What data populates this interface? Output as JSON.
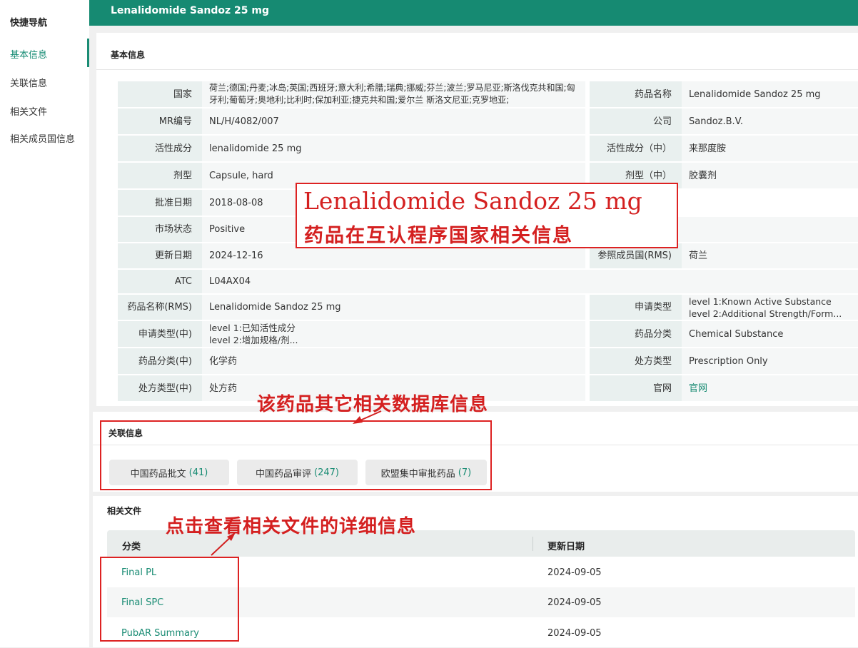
{
  "nav": {
    "title": "快捷导航",
    "items": [
      {
        "label": "基本信息",
        "active": true
      },
      {
        "label": "关联信息"
      },
      {
        "label": "相关文件"
      },
      {
        "label": "相关成员国信息"
      }
    ]
  },
  "header": {
    "title": "Lenalidomide Sandoz 25 mg"
  },
  "basic": {
    "title": "基本信息",
    "country_label": "国家",
    "country_value": "荷兰;德国;丹麦;冰岛;英国;西班牙;意大利;希腊;瑞典;挪威;芬兰;波兰;罗马尼亚;斯洛伐克共和国;匈牙利;葡萄牙;奥地利;比利时;保加利亚;捷克共和国;爱尔兰 斯洛文尼亚;克罗地亚;",
    "rows_left": [
      {
        "label": "MR编号",
        "value": "NL/H/4082/007"
      },
      {
        "label": "活性成分",
        "value": "lenalidomide 25 mg"
      },
      {
        "label": "剂型",
        "value": "Capsule, hard"
      },
      {
        "label": "批准日期",
        "value": "2018-08-08"
      },
      {
        "label": "市场状态",
        "value": " Positive"
      },
      {
        "label": "更新日期",
        "value": "2024-12-16"
      },
      {
        "label": "ATC",
        "value": " L04AX04"
      },
      {
        "label": "药品名称(RMS)",
        "value": "Lenalidomide Sandoz 25 mg"
      },
      {
        "label": "申请类型(中)",
        "value": "level 1:已知活性成分\nlevel 2:增加规格/剂..."
      },
      {
        "label": "药品分类(中)",
        "value": "化学药"
      },
      {
        "label": "处方类型(中)",
        "value": "处方药"
      }
    ],
    "rows_right": [
      {
        "label": "药品名称",
        "value": "Lenalidomide Sandoz 25 mg"
      },
      {
        "label": "公司",
        "value": "Sandoz.B.V."
      },
      {
        "label": "活性成分（中）",
        "value": "来那度胺"
      },
      {
        "label": "剂型（中）",
        "value": "胶囊剂"
      },
      {
        "label": "参照成员国(RMS)",
        "value": "荷兰"
      },
      {
        "label": "申请类型",
        "value": "level 1:Known Active Substance\nlevel 2:Additional Strength/Form..."
      },
      {
        "label": "药品分类",
        "value": "Chemical Substance"
      },
      {
        "label": "处方类型",
        "value": "Prescription Only"
      },
      {
        "label": "官网",
        "value": "官网"
      }
    ]
  },
  "related": {
    "title": "关联信息",
    "buttons": [
      {
        "label": "中国药品批文",
        "count": "(41)"
      },
      {
        "label": "中国药品审评",
        "count": "(247)"
      },
      {
        "label": "欧盟集中审批药品",
        "count": "(7)"
      }
    ]
  },
  "files": {
    "title": "相关文件",
    "col_category": "分类",
    "col_date": "更新日期",
    "rows": [
      {
        "name": "Final PL",
        "date": "2024-09-05"
      },
      {
        "name": "Final SPC",
        "date": "2024-09-05"
      },
      {
        "name": "PubAR Summary",
        "date": "2024-09-05"
      }
    ]
  },
  "annotations": {
    "main_line1": "Lenalidomide Sandoz 25 mg",
    "main_line2": "药品在互认程序国家相关信息",
    "related_note": "该药品其它相关数据库信息",
    "files_note": "点击查看相关文件的详细信息"
  },
  "colors": {
    "brand": "#168a72",
    "link": "#1a8c74",
    "annotation": "#d22020"
  }
}
